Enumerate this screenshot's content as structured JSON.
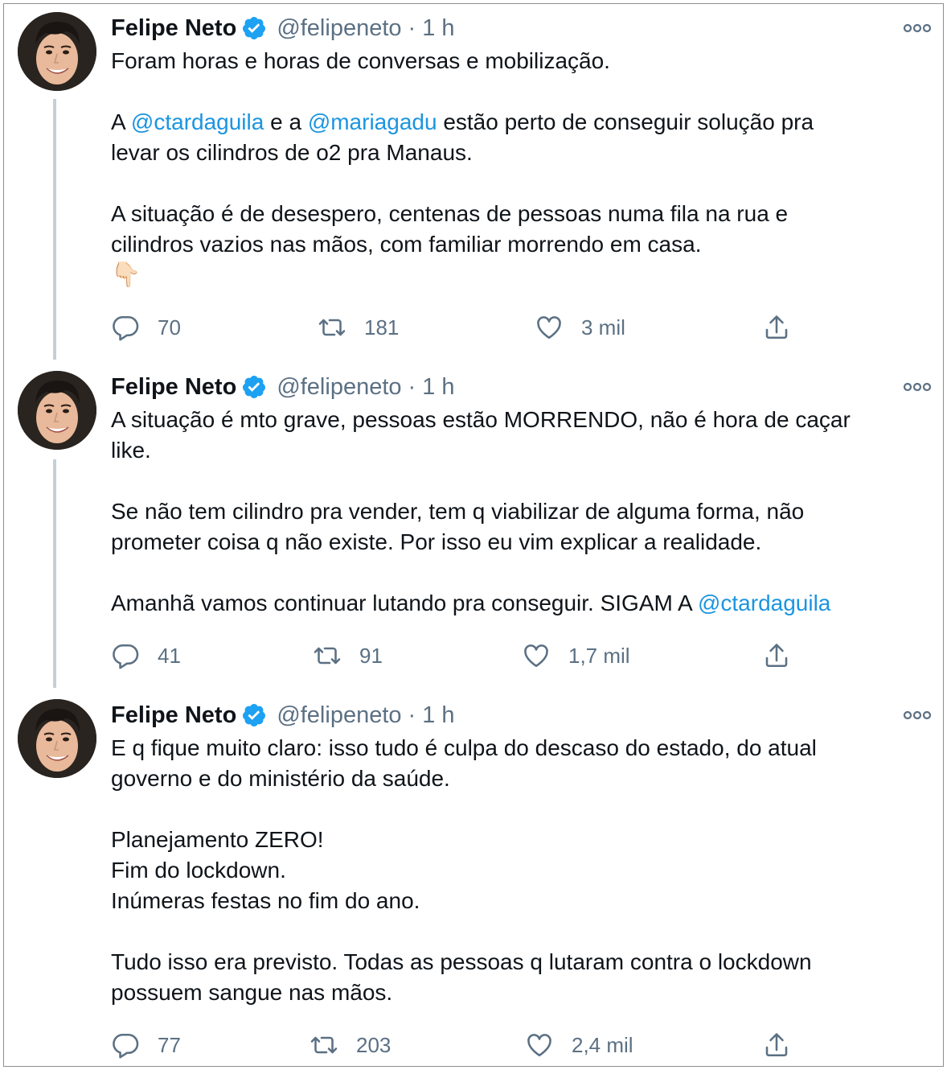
{
  "tweets": [
    {
      "author": {
        "name": "Felipe Neto",
        "handle": "@felipeneto"
      },
      "separator": "·",
      "time": "1 h",
      "lines": [
        {
          "parts": [
            {
              "text": "Foram horas e horas de conversas e mobilização."
            }
          ]
        },
        {
          "gap": true
        },
        {
          "parts": [
            {
              "text": "A "
            },
            {
              "text": "@ctardaguila",
              "mention": true
            },
            {
              "text": " e a "
            },
            {
              "text": "@mariagadu",
              "mention": true
            },
            {
              "text": " estão perto de conseguir solução pra"
            }
          ]
        },
        {
          "parts": [
            {
              "text": "levar os cilindros de o2 pra Manaus."
            }
          ]
        },
        {
          "gap": true
        },
        {
          "parts": [
            {
              "text": "A situação é de desespero, centenas de pessoas numa fila na rua e"
            }
          ]
        },
        {
          "parts": [
            {
              "text": "cilindros vazios nas mãos, com familiar morrendo em casa."
            }
          ]
        },
        {
          "parts": [
            {
              "text": "👇🏻",
              "emoji": true
            }
          ]
        }
      ],
      "stats": {
        "replies": "70",
        "retweets": "181",
        "likes": "3 mil"
      }
    },
    {
      "author": {
        "name": "Felipe Neto",
        "handle": "@felipeneto"
      },
      "separator": "·",
      "time": "1 h",
      "lines": [
        {
          "parts": [
            {
              "text": "A situação é mto grave, pessoas estão MORRENDO, não é hora de caçar"
            }
          ]
        },
        {
          "parts": [
            {
              "text": "like."
            }
          ]
        },
        {
          "gap": true
        },
        {
          "parts": [
            {
              "text": "Se não tem cilindro pra vender, tem q viabilizar de alguma forma, não"
            }
          ]
        },
        {
          "parts": [
            {
              "text": "prometer coisa q não existe. Por isso eu vim explicar a realidade."
            }
          ]
        },
        {
          "gap": true
        },
        {
          "parts": [
            {
              "text": "Amanhã vamos continuar lutando pra conseguir. SIGAM A "
            },
            {
              "text": "@ctardaguila",
              "mention": true
            }
          ]
        }
      ],
      "stats": {
        "replies": "41",
        "retweets": "91",
        "likes": "1,7 mil"
      }
    },
    {
      "author": {
        "name": "Felipe Neto",
        "handle": "@felipeneto"
      },
      "separator": "·",
      "time": "1 h",
      "lines": [
        {
          "parts": [
            {
              "text": "E q fique muito claro: isso tudo é culpa do descaso do estado, do atual"
            }
          ]
        },
        {
          "parts": [
            {
              "text": "governo e do ministério da saúde."
            }
          ]
        },
        {
          "gap": true
        },
        {
          "parts": [
            {
              "text": "Planejamento ZERO!"
            }
          ]
        },
        {
          "parts": [
            {
              "text": "Fim do lockdown."
            }
          ]
        },
        {
          "parts": [
            {
              "text": "Inúmeras festas no fim do ano."
            }
          ]
        },
        {
          "gap": true
        },
        {
          "parts": [
            {
              "text": "Tudo isso era previsto. Todas as pessoas q lutaram contra o lockdown"
            }
          ]
        },
        {
          "parts": [
            {
              "text": "possuem sangue nas mãos."
            }
          ]
        }
      ],
      "stats": {
        "replies": "77",
        "retweets": "203",
        "likes": "2,4 mil"
      }
    }
  ],
  "colors": {
    "mention": "#1b95e0",
    "secondary": "#5b7083",
    "verified": "#1da1f2",
    "thread_line": "#c4cfd6"
  },
  "icons": [
    "verified-badge-icon",
    "more-options-icon",
    "reply-icon",
    "retweet-icon",
    "like-icon",
    "share-icon"
  ]
}
